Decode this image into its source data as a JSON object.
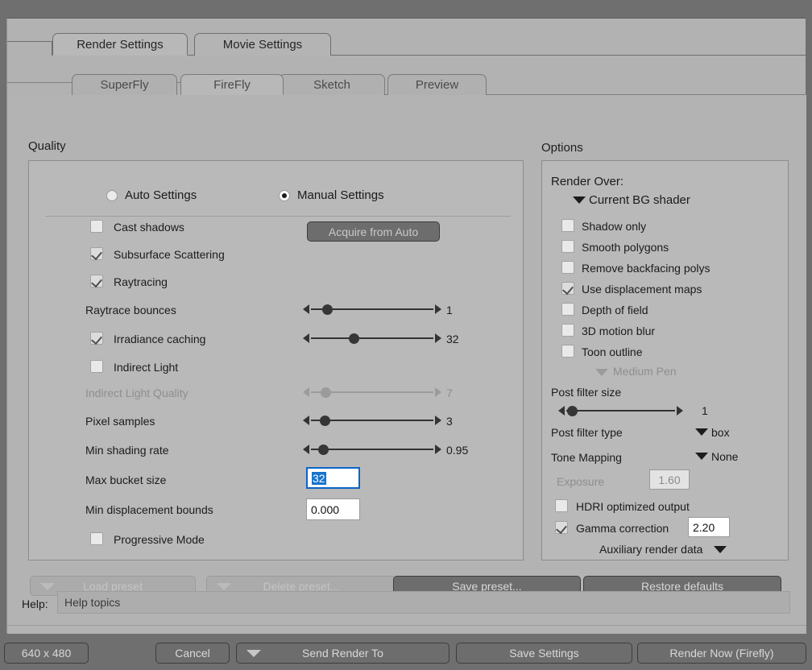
{
  "window": {
    "primary_tabs": [
      {
        "label": "Render Settings",
        "active": true
      },
      {
        "label": "Movie Settings",
        "active": false
      }
    ],
    "engine_tabs": [
      {
        "label": "SuperFly",
        "active": false
      },
      {
        "label": "FireFly",
        "active": true
      },
      {
        "label": "Sketch",
        "active": false
      },
      {
        "label": "Preview",
        "active": false
      }
    ]
  },
  "quality": {
    "title": "Quality",
    "mode": {
      "auto_label": "Auto Settings",
      "auto_selected": false,
      "manual_label": "Manual Settings",
      "manual_selected": true
    },
    "acquire_button": "Acquire from Auto",
    "checkboxes": [
      {
        "label": "Cast shadows",
        "checked": false,
        "enabled": true
      },
      {
        "label": "Subsurface Scattering",
        "checked": true,
        "enabled": true
      },
      {
        "label": "Raytracing",
        "checked": true,
        "enabled": true
      }
    ],
    "raytrace_bounces": {
      "label": "Raytrace bounces",
      "value": "1",
      "fraction": 0.14,
      "enabled": true
    },
    "irradiance_caching": {
      "label": "Irradiance caching",
      "checked": true,
      "value": "32",
      "fraction": 0.37,
      "enabled": true
    },
    "indirect_light": {
      "label": "Indirect Light",
      "checked": false,
      "enabled": true
    },
    "indirect_light_quality": {
      "label": "Indirect Light Quality",
      "value": "7",
      "fraction": 0.13,
      "enabled": false
    },
    "pixel_samples": {
      "label": "Pixel samples",
      "value": "3",
      "fraction": 0.12,
      "enabled": true
    },
    "min_shading_rate": {
      "label": "Min shading rate",
      "value": "0.95",
      "fraction": 0.11,
      "enabled": true
    },
    "max_bucket_size": {
      "label": "Max bucket size",
      "value": "32",
      "focused": true,
      "selected": true
    },
    "min_displacement_bounds": {
      "label": "Min displacement bounds",
      "value": "0.000",
      "focused": false
    },
    "progressive_mode": {
      "label": "Progressive Mode",
      "checked": false
    }
  },
  "options": {
    "title": "Options",
    "render_over_label": "Render Over:",
    "render_over_value": "Current BG shader",
    "checkboxes": [
      {
        "label": "Shadow only",
        "checked": false
      },
      {
        "label": "Smooth polygons",
        "checked": false
      },
      {
        "label": "Remove backfacing polys",
        "checked": false
      },
      {
        "label": "Use displacement maps",
        "checked": true
      },
      {
        "label": "Depth of field",
        "checked": false
      },
      {
        "label": "3D motion blur",
        "checked": false
      },
      {
        "label": "Toon outline",
        "checked": false
      }
    ],
    "toon_pen": {
      "label": "Medium Pen",
      "enabled": false
    },
    "post_filter_size": {
      "label": "Post filter size",
      "value": "1",
      "fraction": 0.04
    },
    "post_filter_type": {
      "label": "Post filter type",
      "value": "box"
    },
    "tone_mapping": {
      "label": "Tone Mapping",
      "value": "None"
    },
    "exposure": {
      "label": "Exposure",
      "value": "1.60",
      "enabled": false
    },
    "hdri_optimized": {
      "label": "HDRI optimized output",
      "checked": false
    },
    "gamma_correction": {
      "label": "Gamma correction",
      "checked": true,
      "value": "2.20"
    },
    "auxiliary_render_data": {
      "label": "Auxiliary render data"
    }
  },
  "presets": {
    "load": "Load preset",
    "delete": "Delete preset...",
    "save": "Save preset...",
    "restore": "Restore defaults"
  },
  "help": {
    "label": "Help:",
    "value": "Help topics"
  },
  "bottom": {
    "resolution": "640 x 480",
    "cancel": "Cancel",
    "send_render_to": "Send Render To",
    "save_settings": "Save Settings",
    "render_now": "Render Now (Firefly)"
  },
  "colors": {
    "dialog_bg": "#b3b3b3",
    "group_bg": "#b9b9b9",
    "chrome": "#6f6f6f",
    "button": "#6d6d6d",
    "accent_selection": "#1874cd",
    "focus_border": "#0a64c8"
  }
}
